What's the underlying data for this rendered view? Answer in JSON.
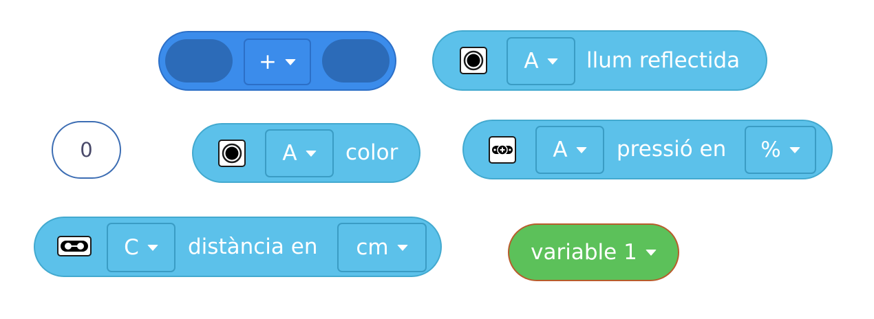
{
  "operator_block": {
    "operator": "+"
  },
  "reflected_light_block": {
    "port": "A",
    "label": "llum reflectida",
    "icon": "color-sensor-icon"
  },
  "number_block": {
    "value": "0"
  },
  "color_block": {
    "port": "A",
    "label": "color",
    "icon": "color-sensor-icon"
  },
  "pressure_block": {
    "port": "A",
    "label": "pressió en",
    "unit": "%",
    "icon": "force-sensor-icon"
  },
  "distance_block": {
    "port": "C",
    "label": "distància en",
    "unit": "cm",
    "icon": "distance-sensor-icon"
  },
  "variable_block": {
    "name": "variable 1"
  },
  "colors": {
    "sensor": "#5cc1ea",
    "operator": "#3b8ceb",
    "variable": "#5cc15a"
  }
}
